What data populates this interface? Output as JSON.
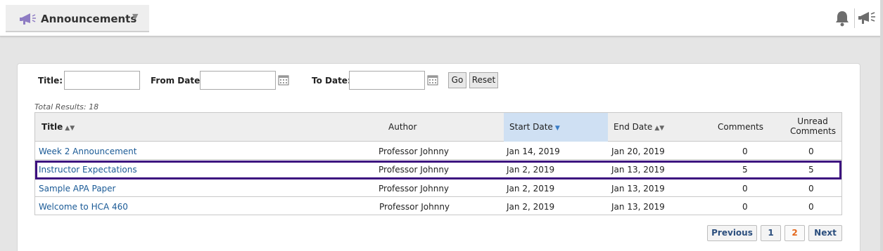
{
  "tool_menu": {
    "title": "Announcements",
    "icon": "megaphone-icon",
    "caret_icon": "caret-down-icon"
  },
  "header_icons": [
    "bell-icon",
    "megaphone-icon"
  ],
  "filters": {
    "title_label": "Title:",
    "title_value": "",
    "from_label": "From Date:",
    "from_value": "",
    "to_label": "To Date:",
    "to_value": "",
    "go_label": "Go",
    "reset_label": "Reset"
  },
  "total_results": "Total Results: 18",
  "table": {
    "headers": {
      "title": "Title",
      "author": "Author",
      "start_date": "Start Date",
      "end_date": "End Date",
      "comments": "Comments",
      "unread_line1": "Unread",
      "unread_line2": "Comments"
    },
    "sorted_column": "Start Date",
    "rows": [
      {
        "title": "Week 2 Announcement",
        "author": "Professor Johnny",
        "start": "Jan 14, 2019",
        "end": "Jan 20, 2019",
        "comments": "0",
        "unread": "0"
      },
      {
        "title": "Instructor Expectations",
        "author": "Professor Johnny",
        "start": "Jan 2, 2019",
        "end": "Jan 13, 2019",
        "comments": "5",
        "unread": "5"
      },
      {
        "title": "Sample APA Paper",
        "author": "Professor Johnny",
        "start": "Jan 2, 2019",
        "end": "Jan 13, 2019",
        "comments": "0",
        "unread": "0"
      },
      {
        "title": "Welcome to HCA 460",
        "author": "Professor Johnny",
        "start": "Jan 2, 2019",
        "end": "Jan 13, 2019",
        "comments": "0",
        "unread": "0"
      }
    ]
  },
  "pagination": {
    "previous": "Previous",
    "page1": "1",
    "page2": "2",
    "next": "Next",
    "current_page": "2"
  },
  "colors": {
    "accent_purple": "#3c0f7f",
    "link": "#1a5a96",
    "sorted_header": "#cfe0f3",
    "current_page": "#e4671c"
  }
}
